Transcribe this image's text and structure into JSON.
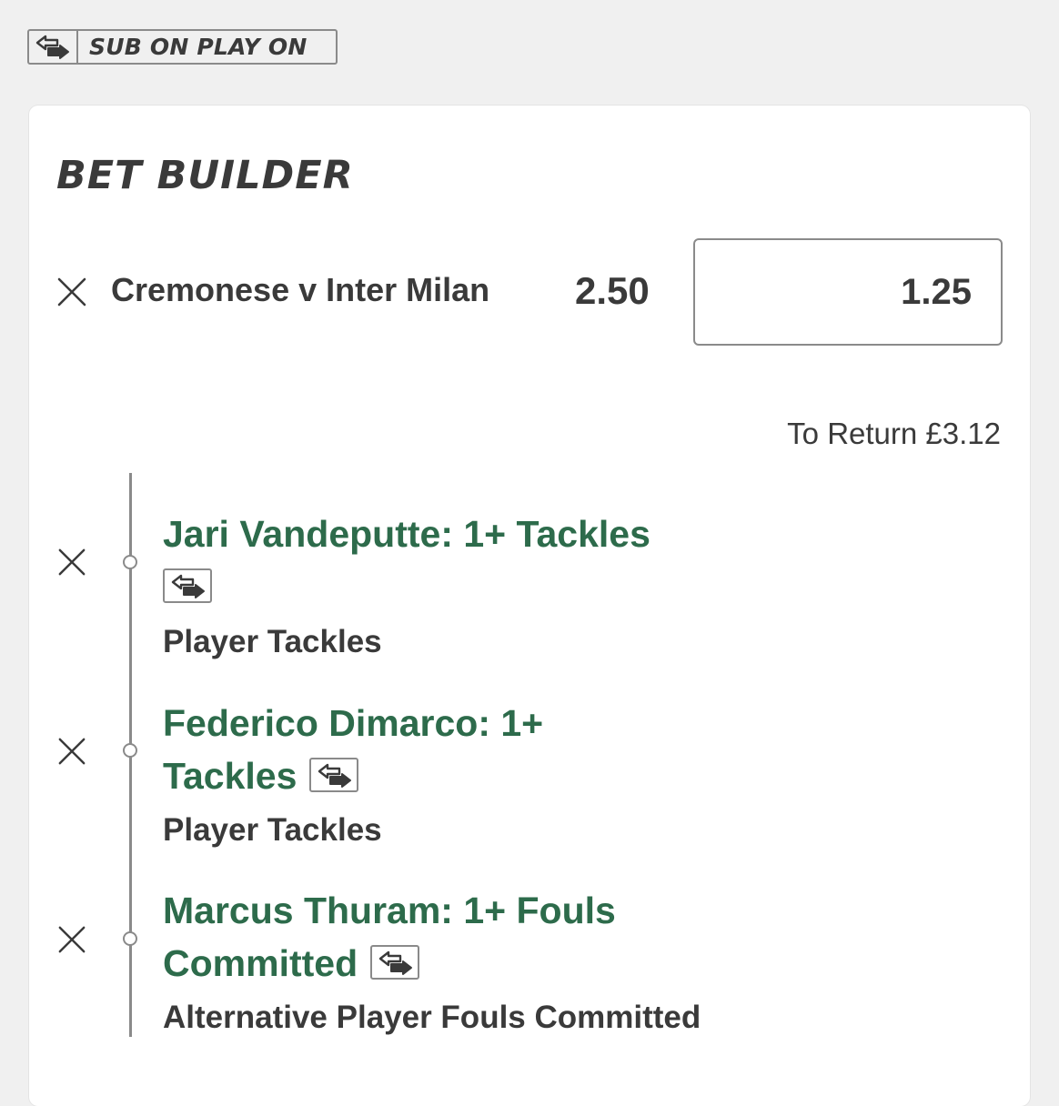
{
  "badge": {
    "label": "SUB ON PLAY ON",
    "icon": "substitution-arrows-icon"
  },
  "bet_builder": {
    "title": "BET BUILDER",
    "match": "Cremonese v Inter Milan",
    "odds": "2.50",
    "stake": "1.25",
    "to_return": "To Return £3.12",
    "legs": [
      {
        "selection_line1": "Jari Vandeputte: 1+ Tackles",
        "selection_line2": "",
        "market": "Player Tackles"
      },
      {
        "selection_line1": "Federico Dimarco: 1+",
        "selection_line2": "Tackles",
        "market": "Player Tackles"
      },
      {
        "selection_line1": "Marcus Thuram: 1+ Fouls",
        "selection_line2": "Committed",
        "market": "Alternative Player Fouls Committed"
      }
    ]
  },
  "colors": {
    "background": "#f0f0f0",
    "card": "#ffffff",
    "selection_green": "#2d6b4b",
    "text_dark": "#3a3a3a",
    "border_grey": "#8a8a8a"
  }
}
